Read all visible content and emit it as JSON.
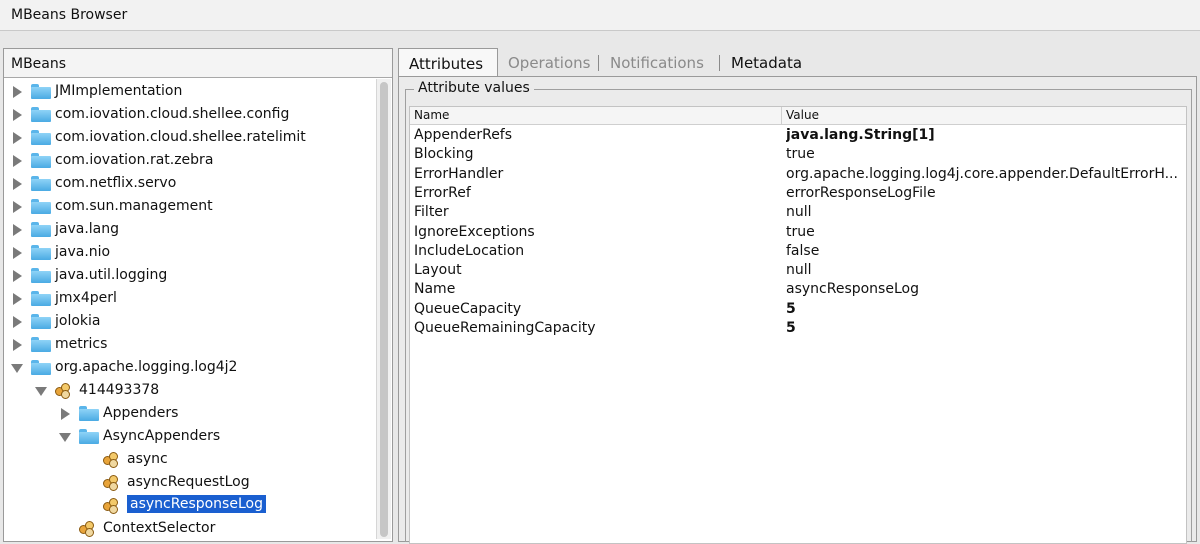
{
  "window": {
    "title": "MBeans Browser"
  },
  "left_panel": {
    "header": "MBeans"
  },
  "tree": [
    {
      "label": "JMImplementation",
      "type": "folder",
      "expanded": false
    },
    {
      "label": "com.iovation.cloud.shellee.config",
      "type": "folder",
      "expanded": false
    },
    {
      "label": "com.iovation.cloud.shellee.ratelimit",
      "type": "folder",
      "expanded": false
    },
    {
      "label": "com.iovation.rat.zebra",
      "type": "folder",
      "expanded": false
    },
    {
      "label": "com.netflix.servo",
      "type": "folder",
      "expanded": false
    },
    {
      "label": "com.sun.management",
      "type": "folder",
      "expanded": false
    },
    {
      "label": "java.lang",
      "type": "folder",
      "expanded": false
    },
    {
      "label": "java.nio",
      "type": "folder",
      "expanded": false
    },
    {
      "label": "java.util.logging",
      "type": "folder",
      "expanded": false
    },
    {
      "label": "jmx4perl",
      "type": "folder",
      "expanded": false
    },
    {
      "label": "jolokia",
      "type": "folder",
      "expanded": false
    },
    {
      "label": "metrics",
      "type": "folder",
      "expanded": false
    },
    {
      "label": "org.apache.logging.log4j2",
      "type": "folder",
      "expanded": true
    },
    {
      "label": "414493378",
      "type": "bean",
      "expanded": true
    },
    {
      "label": "Appenders",
      "type": "folder",
      "expanded": false
    },
    {
      "label": "AsyncAppenders",
      "type": "folder",
      "expanded": true
    },
    {
      "label": "async",
      "type": "bean"
    },
    {
      "label": "asyncRequestLog",
      "type": "bean"
    },
    {
      "label": "asyncResponseLog",
      "type": "bean",
      "selected": true
    },
    {
      "label": "ContextSelector",
      "type": "bean"
    }
  ],
  "tabs": [
    {
      "label": "Attributes",
      "state": "active"
    },
    {
      "label": "Operations",
      "state": "disabled"
    },
    {
      "label": "Notifications",
      "state": "disabled"
    },
    {
      "label": "Metadata",
      "state": "enabled"
    }
  ],
  "attributes": {
    "group_title": "Attribute values",
    "columns": {
      "name": "Name",
      "value": "Value"
    },
    "rows": [
      {
        "name": "AppenderRefs",
        "value": "java.lang.String[1]",
        "bold": true
      },
      {
        "name": "Blocking",
        "value": "true"
      },
      {
        "name": "ErrorHandler",
        "value": "org.apache.logging.log4j.core.appender.DefaultErrorH..."
      },
      {
        "name": "ErrorRef",
        "value": "errorResponseLogFile"
      },
      {
        "name": "Filter",
        "value": "null"
      },
      {
        "name": "IgnoreExceptions",
        "value": "true"
      },
      {
        "name": "IncludeLocation",
        "value": "false"
      },
      {
        "name": "Layout",
        "value": "null"
      },
      {
        "name": "Name",
        "value": "asyncResponseLog"
      },
      {
        "name": "QueueCapacity",
        "value": "5",
        "bold": true
      },
      {
        "name": "QueueRemainingCapacity",
        "value": "5",
        "bold": true
      }
    ]
  },
  "colors": {
    "selection": "#1a5fd0",
    "folder": "#4aaae3"
  }
}
